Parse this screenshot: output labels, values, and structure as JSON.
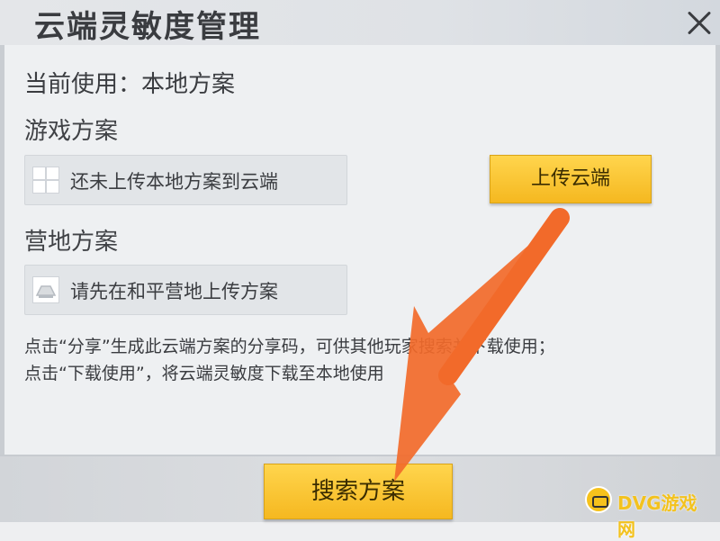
{
  "dialog": {
    "title": "云端灵敏度管理",
    "current_usage": "当前使用：本地方案"
  },
  "game_plan": {
    "heading": "游戏方案",
    "status_text": "还未上传本地方案到云端",
    "upload_label": "上传云端"
  },
  "camp_plan": {
    "heading": "营地方案",
    "status_text": "请先在和平营地上传方案"
  },
  "description": {
    "line1": "点击“分享”生成此云端方案的分享码，可供其他玩家搜索并下载使用；",
    "line2": "点击“下载使用”，将云端灵敏度下载至本地使用"
  },
  "footer": {
    "search_label": "搜索方案"
  },
  "watermark": {
    "text": "DVG游戏网"
  },
  "colors": {
    "accent_yellow": "#f5b820",
    "annotation_arrow": "#f26a2a"
  },
  "icons": {
    "close": "close-icon",
    "game_plan": "grid-icon",
    "camp_plan": "camp-icon",
    "annotation": "arrow-annotation"
  }
}
